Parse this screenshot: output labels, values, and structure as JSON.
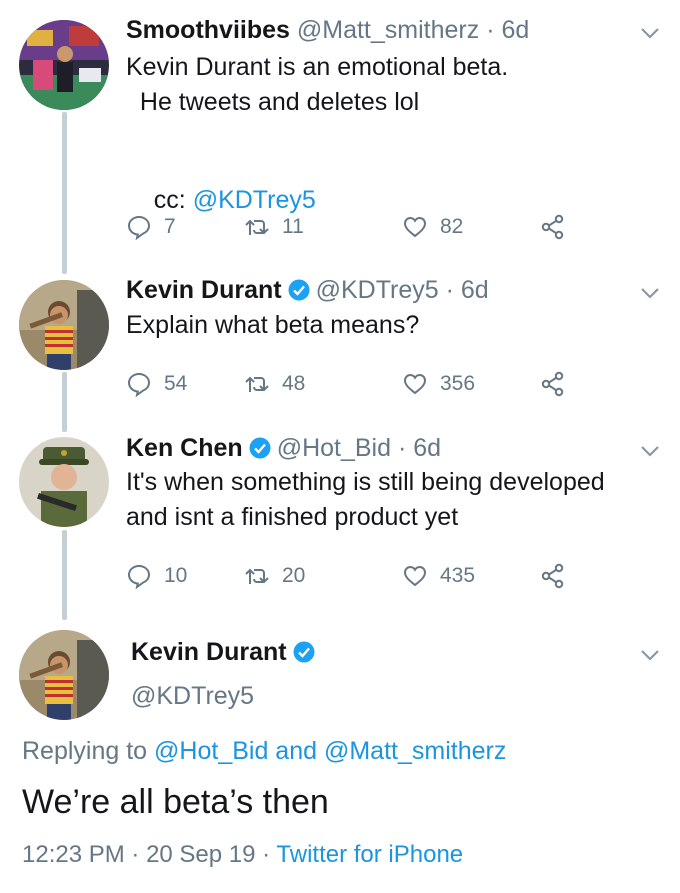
{
  "tweets": [
    {
      "name": "Smoothviibes",
      "handle": "@Matt_smitherz",
      "sep": " · ",
      "time": "6d",
      "verified": false,
      "lines": [
        "Kevin Durant is an emotional beta.",
        "  He tweets and deletes lol",
        "",
        "cc: "
      ],
      "mention": "@KDTrey5",
      "replies": "7",
      "retweets": "11",
      "likes": "82"
    },
    {
      "name": "Kevin Durant",
      "handle": "@KDTrey5",
      "sep": " · ",
      "time": "6d",
      "verified": true,
      "lines": [
        "Explain what beta means?"
      ],
      "replies": "54",
      "retweets": "48",
      "likes": "356"
    },
    {
      "name": "Ken Chen",
      "handle": "@Hot_Bid",
      "sep": " · ",
      "time": "6d",
      "verified": true,
      "lines": [
        "It's when something is still being developed",
        "and isnt a finished product yet"
      ],
      "replies": "10",
      "retweets": "20",
      "likes": "435"
    }
  ],
  "main": {
    "name": "Kevin Durant",
    "handle": "@KDTrey5",
    "replying_prefix": "Replying to ",
    "replying_to_1": "@Hot_Bid",
    "replying_and": " and ",
    "replying_to_2": "@Matt_smitherz",
    "text": "We’re all beta’s then",
    "time": "12:23 PM",
    "sep": " · ",
    "date": "20 Sep 19",
    "client": "Twitter for iPhone"
  },
  "colors": {
    "link": "#1b95e0",
    "secondary": "#657786",
    "verified": "#1da1f2",
    "thread_line": "#c4cfd6"
  },
  "icons": [
    "reply-icon",
    "retweet-icon",
    "like-icon",
    "share-icon",
    "chevron-down-icon",
    "verified-badge-icon"
  ]
}
